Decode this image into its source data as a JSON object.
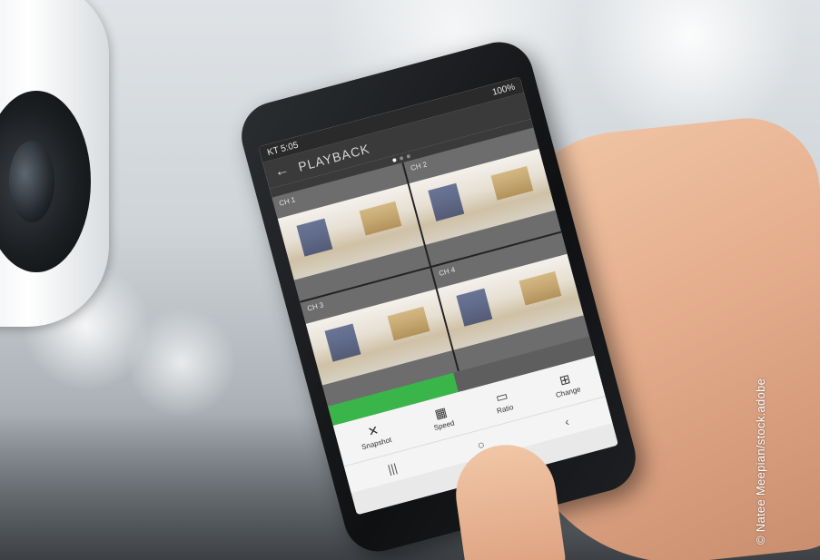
{
  "phone": {
    "status_time": "KT 5:05",
    "status_right": "100%",
    "app_title": "PLAYBACK",
    "channels": [
      "CH 1",
      "CH 2",
      "CH 3",
      "CH 4"
    ],
    "timeline_label": "",
    "toolbar": [
      {
        "label": "Snapshot",
        "icon": "snapshot-icon",
        "glyph": "✕"
      },
      {
        "label": "Speed",
        "icon": "speed-icon",
        "glyph": "▦"
      },
      {
        "label": "Ratio",
        "icon": "ratio-icon",
        "glyph": "▭"
      },
      {
        "label": "Change",
        "icon": "change-icon",
        "glyph": "⊞"
      }
    ],
    "nav": {
      "recent": "|||",
      "home": "○",
      "back": "‹"
    }
  },
  "credit": "© Natee Meepian/stock.adobe"
}
